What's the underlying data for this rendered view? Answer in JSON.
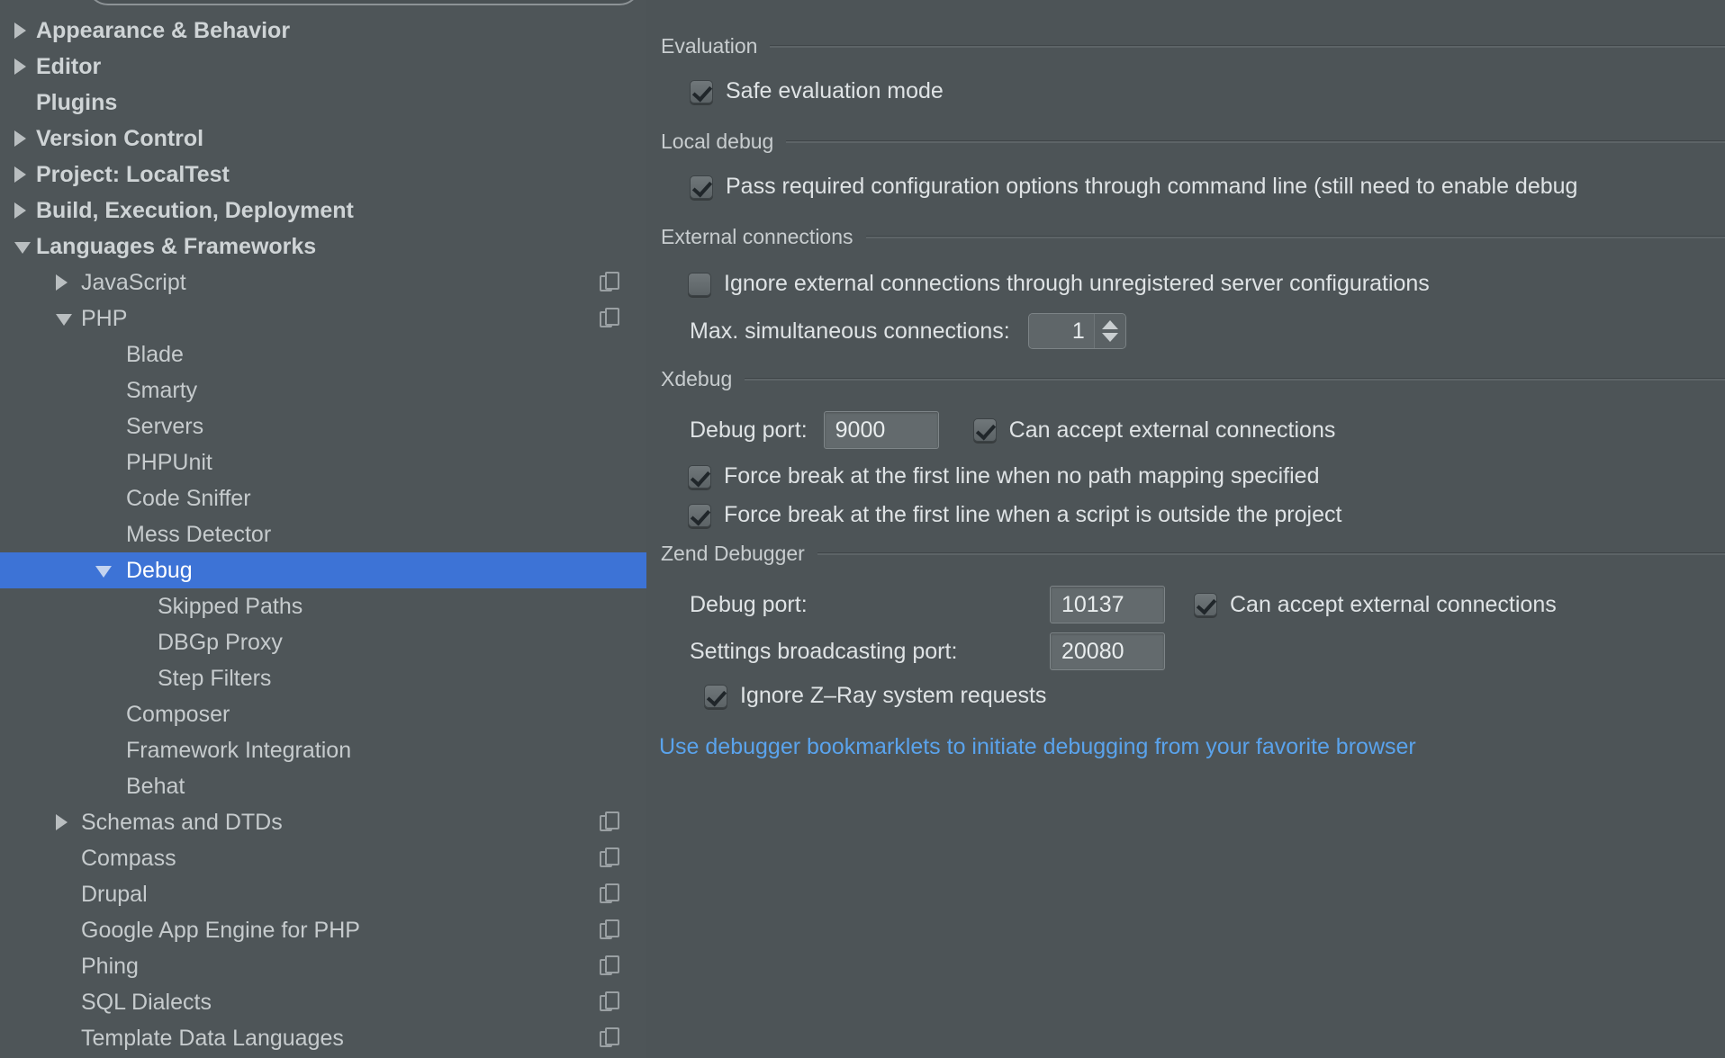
{
  "sidebar": {
    "search": {
      "value": "",
      "placeholder": ""
    },
    "items": [
      {
        "label": "Appearance & Behavior",
        "indent": 0,
        "arrow": "right",
        "bold": true,
        "copy": false,
        "selected": false
      },
      {
        "label": "Editor",
        "indent": 0,
        "arrow": "right",
        "bold": true,
        "copy": false,
        "selected": false
      },
      {
        "label": "Plugins",
        "indent": 0,
        "arrow": "none",
        "bold": true,
        "copy": false,
        "selected": false
      },
      {
        "label": "Version Control",
        "indent": 0,
        "arrow": "right",
        "bold": true,
        "copy": false,
        "selected": false
      },
      {
        "label": "Project: LocalTest",
        "indent": 0,
        "arrow": "right",
        "bold": true,
        "copy": false,
        "selected": false
      },
      {
        "label": "Build, Execution, Deployment",
        "indent": 0,
        "arrow": "right",
        "bold": true,
        "copy": false,
        "selected": false
      },
      {
        "label": "Languages & Frameworks",
        "indent": 0,
        "arrow": "down",
        "bold": true,
        "copy": false,
        "selected": false
      },
      {
        "label": "JavaScript",
        "indent": 1,
        "arrow": "right",
        "bold": false,
        "copy": true,
        "selected": false
      },
      {
        "label": "PHP",
        "indent": 1,
        "arrow": "down",
        "bold": false,
        "copy": true,
        "selected": false
      },
      {
        "label": "Blade",
        "indent": 2,
        "arrow": "none",
        "bold": false,
        "copy": false,
        "selected": false
      },
      {
        "label": "Smarty",
        "indent": 2,
        "arrow": "none",
        "bold": false,
        "copy": false,
        "selected": false
      },
      {
        "label": "Servers",
        "indent": 2,
        "arrow": "none",
        "bold": false,
        "copy": false,
        "selected": false
      },
      {
        "label": "PHPUnit",
        "indent": 2,
        "arrow": "none",
        "bold": false,
        "copy": false,
        "selected": false
      },
      {
        "label": "Code Sniffer",
        "indent": 2,
        "arrow": "none",
        "bold": false,
        "copy": false,
        "selected": false
      },
      {
        "label": "Mess Detector",
        "indent": 2,
        "arrow": "none",
        "bold": false,
        "copy": false,
        "selected": false
      },
      {
        "label": "Debug",
        "indent": 2,
        "arrow": "down",
        "bold": false,
        "copy": false,
        "selected": true
      },
      {
        "label": "Skipped Paths",
        "indent": 3,
        "arrow": "none",
        "bold": false,
        "copy": false,
        "selected": false
      },
      {
        "label": "DBGp Proxy",
        "indent": 3,
        "arrow": "none",
        "bold": false,
        "copy": false,
        "selected": false
      },
      {
        "label": "Step Filters",
        "indent": 3,
        "arrow": "none",
        "bold": false,
        "copy": false,
        "selected": false
      },
      {
        "label": "Composer",
        "indent": 2,
        "arrow": "none",
        "bold": false,
        "copy": false,
        "selected": false
      },
      {
        "label": "Framework Integration",
        "indent": 2,
        "arrow": "none",
        "bold": false,
        "copy": false,
        "selected": false
      },
      {
        "label": "Behat",
        "indent": 2,
        "arrow": "none",
        "bold": false,
        "copy": false,
        "selected": false
      },
      {
        "label": "Schemas and DTDs",
        "indent": 1,
        "arrow": "right",
        "bold": false,
        "copy": true,
        "selected": false
      },
      {
        "label": "Compass",
        "indent": 1,
        "arrow": "none",
        "bold": false,
        "copy": true,
        "selected": false
      },
      {
        "label": "Drupal",
        "indent": 1,
        "arrow": "none",
        "bold": false,
        "copy": true,
        "selected": false
      },
      {
        "label": "Google App Engine for PHP",
        "indent": 1,
        "arrow": "none",
        "bold": false,
        "copy": true,
        "selected": false
      },
      {
        "label": "Phing",
        "indent": 1,
        "arrow": "none",
        "bold": false,
        "copy": true,
        "selected": false
      },
      {
        "label": "SQL Dialects",
        "indent": 1,
        "arrow": "none",
        "bold": false,
        "copy": true,
        "selected": false
      },
      {
        "label": "Template Data Languages",
        "indent": 1,
        "arrow": "none",
        "bold": false,
        "copy": true,
        "selected": false
      }
    ]
  },
  "main": {
    "evaluation": {
      "title": "Evaluation",
      "safe_evaluation_mode": {
        "label": "Safe evaluation mode",
        "checked": true
      }
    },
    "local_debug": {
      "title": "Local debug",
      "pass_required": {
        "label": "Pass required configuration options through command line (still need to enable debug",
        "checked": true
      }
    },
    "external_connections": {
      "title": "External connections",
      "ignore_external": {
        "label": "Ignore external connections through unregistered server configurations",
        "checked": false
      },
      "max_connections_label": "Max. simultaneous connections:",
      "max_connections_value": "1"
    },
    "xdebug": {
      "title": "Xdebug",
      "debug_port_label": "Debug port:",
      "debug_port_value": "9000",
      "can_accept": {
        "label": "Can accept external connections",
        "checked": true
      },
      "force_break_no_mapping": {
        "label": "Force break at the first line when no path mapping specified",
        "checked": true
      },
      "force_break_outside_project": {
        "label": "Force break at the first line when a script is outside the project",
        "checked": true
      }
    },
    "zend_debugger": {
      "title": "Zend Debugger",
      "debug_port_label": "Debug port:",
      "debug_port_value": "10137",
      "can_accept": {
        "label": "Can accept external connections",
        "checked": true
      },
      "broadcasting_label": "Settings broadcasting port:",
      "broadcasting_value": "20080",
      "ignore_zray": {
        "label": "Ignore Z–Ray system requests",
        "checked": true
      }
    },
    "bookmarklets_link": "Use debugger bookmarklets to initiate debugging from your favorite browser"
  },
  "colors": {
    "background": "#4d5457",
    "sidebar": "#4e5558",
    "selection": "#3d73d6",
    "link": "#5aa3ec",
    "text": "#dfe3e5",
    "muted_text": "#c8cdcf"
  }
}
